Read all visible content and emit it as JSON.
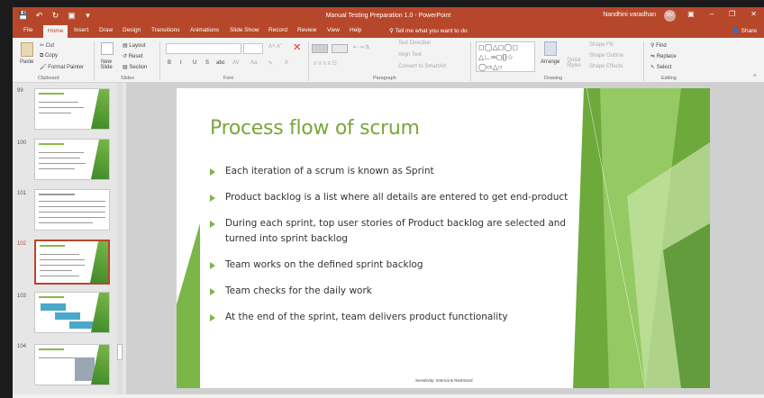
{
  "window": {
    "title": "Manual Testing Preparation 1.0  -  PowerPoint",
    "user_name": "Nandhini varadhan",
    "user_initials": "NV"
  },
  "tabs": [
    "File",
    "Home",
    "Insert",
    "Draw",
    "Design",
    "Transitions",
    "Animations",
    "Slide Show",
    "Record",
    "Review",
    "View",
    "Help"
  ],
  "active_tab": "Home",
  "tell_me": "Tell me what you want to do",
  "share": "Share",
  "ribbon": {
    "clipboard": {
      "paste": "Paste",
      "cut": "Cut",
      "copy": "Copy",
      "format_painter": "Format Painter",
      "label": "Clipboard"
    },
    "slides": {
      "new_slide": "New Slide",
      "layout": "Layout",
      "reset": "Reset",
      "section": "Section",
      "label": "Slides"
    },
    "font": {
      "label": "Font",
      "buttons": [
        "B",
        "I",
        "U",
        "S",
        "abc",
        "AV",
        "Aa",
        "A"
      ]
    },
    "paragraph": {
      "text_direction": "Text Direction",
      "align_text": "Align Text",
      "convert_smartart": "Convert to SmartArt",
      "label": "Paragraph"
    },
    "drawing": {
      "arrange": "Arrange",
      "quick_styles": "Quick Styles",
      "shape_fill": "Shape Fill",
      "shape_outline": "Shape Outline",
      "shape_effects": "Shape Effects",
      "label": "Drawing"
    },
    "editing": {
      "find": "Find",
      "replace": "Replace",
      "select": "Select",
      "label": "Editing"
    }
  },
  "thumbnails": [
    {
      "num": "99",
      "selected": false
    },
    {
      "num": "100",
      "selected": false
    },
    {
      "num": "101",
      "selected": false
    },
    {
      "num": "102",
      "selected": true
    },
    {
      "num": "103",
      "selected": false
    },
    {
      "num": "104",
      "selected": false
    }
  ],
  "slide": {
    "title": "Process flow of scrum",
    "bullets": [
      "Each iteration of a scrum is known as Sprint",
      "Product backlog is a list where all details are entered to get end-product",
      "During each sprint, top user stories of Product backlog are selected and turned into sprint backlog",
      "Team works on the defined sprint backlog",
      "Team checks for the daily work",
      "At the end of the sprint, team delivers product functionality"
    ],
    "footer": "Sensitivity: Internal & Restricted"
  },
  "colors": {
    "accent": "#b7472a",
    "slide_green": "#7ab648",
    "title_green": "#7aa63a"
  }
}
